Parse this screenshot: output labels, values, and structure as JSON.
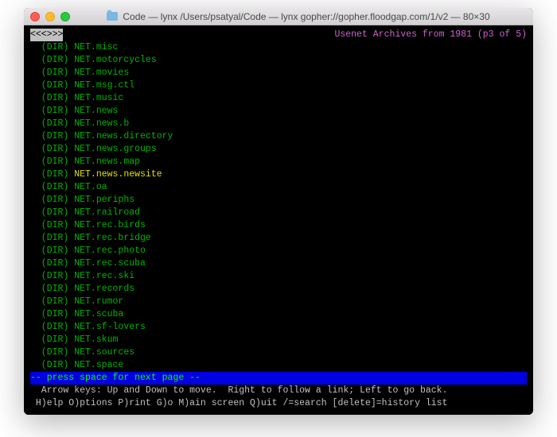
{
  "window": {
    "title": "Code — lynx  /Users/psatyal/Code — lynx gopher://gopher.floodgap.com/1/v2 — 80×30"
  },
  "header": {
    "nav_brackets": "<<<>>>",
    "page_heading": "Usenet Archives from 1981 (p3 of 5)"
  },
  "selected_index": 10,
  "entries": [
    {
      "type": "(DIR)",
      "name": "NET.misc"
    },
    {
      "type": "(DIR)",
      "name": "NET.motorcycles"
    },
    {
      "type": "(DIR)",
      "name": "NET.movies"
    },
    {
      "type": "(DIR)",
      "name": "NET.msg.ctl"
    },
    {
      "type": "(DIR)",
      "name": "NET.music"
    },
    {
      "type": "(DIR)",
      "name": "NET.news"
    },
    {
      "type": "(DIR)",
      "name": "NET.news.b"
    },
    {
      "type": "(DIR)",
      "name": "NET.news.directory"
    },
    {
      "type": "(DIR)",
      "name": "NET.news.groups"
    },
    {
      "type": "(DIR)",
      "name": "NET.news.map"
    },
    {
      "type": "(DIR)",
      "name": "NET.news.newsite"
    },
    {
      "type": "(DIR)",
      "name": "NET.oa"
    },
    {
      "type": "(DIR)",
      "name": "NET.periphs"
    },
    {
      "type": "(DIR)",
      "name": "NET.railroad"
    },
    {
      "type": "(DIR)",
      "name": "NET.rec.birds"
    },
    {
      "type": "(DIR)",
      "name": "NET.rec.bridge"
    },
    {
      "type": "(DIR)",
      "name": "NET.rec.photo"
    },
    {
      "type": "(DIR)",
      "name": "NET.rec.scuba"
    },
    {
      "type": "(DIR)",
      "name": "NET.rec.ski"
    },
    {
      "type": "(DIR)",
      "name": "NET.records"
    },
    {
      "type": "(DIR)",
      "name": "NET.rumor"
    },
    {
      "type": "(DIR)",
      "name": "NET.scuba"
    },
    {
      "type": "(DIR)",
      "name": "NET.sf-lovers"
    },
    {
      "type": "(DIR)",
      "name": "NET.skum"
    },
    {
      "type": "(DIR)",
      "name": "NET.sources"
    },
    {
      "type": "(DIR)",
      "name": "NET.space"
    }
  ],
  "prompt": "-- press space for next page --",
  "help": {
    "line1": "  Arrow keys: Up and Down to move.  Right to follow a link; Left to go back.",
    "line2": " H)elp O)ptions P)rint G)o M)ain screen Q)uit /=search [delete]=history list"
  }
}
